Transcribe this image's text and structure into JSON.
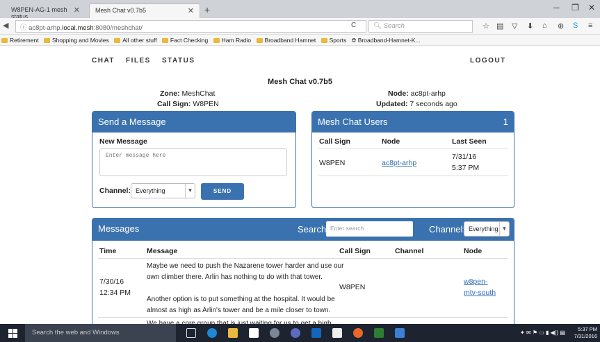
{
  "browser": {
    "tabs": [
      {
        "label": "W8PEN-AG-1 mesh status"
      },
      {
        "label": "Mesh Chat v0.7b5"
      }
    ],
    "url_prefix": "ac8pt-arhp.",
    "url_host": "local.mesh",
    "url_suffix": ":8080/meshchat/",
    "search_placeholder": "Search",
    "bookmarks": [
      "Retirement",
      "Shopping and Movies",
      "All other stuff",
      "Fact Checking",
      "Ham Radio",
      "Broadband Hamnet",
      "Sports",
      "Broadband-Hamnet-K..."
    ]
  },
  "nav": {
    "chat": "CHAT",
    "files": "FILES",
    "status": "STATUS",
    "logout": "LOGOUT"
  },
  "header": {
    "title": "Mesh Chat v0.7b5",
    "zone_label": "Zone:",
    "zone_value": "MeshChat",
    "callsign_label": "Call Sign:",
    "callsign_value": "W8PEN",
    "node_label": "Node:",
    "node_value": "ac8pt-arhp",
    "updated_label": "Updated:",
    "updated_value": "7 seconds ago"
  },
  "send_panel": {
    "title": "Send a Message",
    "new_message_label": "New Message",
    "placeholder": "Enter message here",
    "channel_label": "Channel:",
    "channel_value": "Everything",
    "send_label": "SEND"
  },
  "users_panel": {
    "title": "Mesh Chat Users",
    "count": "1",
    "columns": [
      "Call Sign",
      "Node",
      "Last Seen"
    ],
    "rows": [
      {
        "call_sign": "W8PEN",
        "node": "ac8pt-arhp",
        "last_seen_date": "7/31/16",
        "last_seen_time": "5:37 PM"
      }
    ]
  },
  "messages_panel": {
    "title": "Messages",
    "search_label": "Search:",
    "search_placeholder": "Enter search",
    "channel_label": "Channel:",
    "channel_value": "Everything",
    "columns": [
      "Time",
      "Message",
      "Call Sign",
      "Channel",
      "Node"
    ],
    "rows": [
      {
        "date": "7/30/16",
        "time": "12:34 PM",
        "message_lines": [
          "Maybe we need to push the Nazarene tower harder and use our",
          "own climber there. Arlin has nothing to do with that tower.",
          "",
          "Another option is to put something at the hospital. It would be",
          "almost as high as Arlin's tower and be a mile closer to town."
        ],
        "call_sign": "W8PEN",
        "channel": "",
        "node_line1": "w8pen-",
        "node_line2": "mtv-south"
      }
    ],
    "partial_line": "We have a core group that is just waiting for us to get a high"
  },
  "taskbar": {
    "search_text": "Search the web and Windows",
    "clock_time": "5:37 PM",
    "clock_date": "7/31/2016"
  },
  "colors": {
    "accent": "#3a72b0",
    "link": "#2d6bb5",
    "taskbar": "#1d2430"
  }
}
